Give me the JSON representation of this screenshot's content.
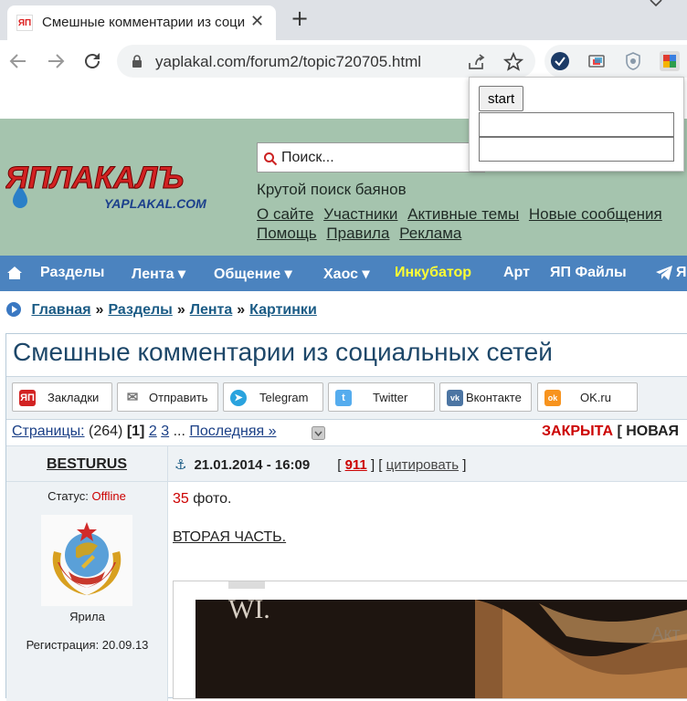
{
  "browser": {
    "tab_title": "Смешные комментарии из социальных сетей",
    "tab_favicon_text": "ЯП",
    "close_glyph": "✕",
    "new_tab_glyph": "+",
    "url": "yaplakal.com/forum2/topic720705.html"
  },
  "popup": {
    "button_label": "start",
    "input1_value": "",
    "input2_value": ""
  },
  "header": {
    "search_placeholder": "Поиск...",
    "search_caption": "Крутой поиск баянов",
    "links_row1": [
      "О сайте",
      "Участники",
      "Активные темы",
      "Новые сообщения"
    ],
    "links_row2": [
      "Помощь",
      "Правила",
      "Реклама"
    ]
  },
  "navbar": {
    "items": [
      "Разделы",
      "Лента ▾",
      "Общение ▾",
      "Хаос ▾",
      "Инкубатор",
      "Арт",
      "ЯП Файлы",
      "Я"
    ],
    "highlight_color": "#ffff33"
  },
  "breadcrumb": {
    "items": [
      "Главная",
      "Разделы",
      "Лента",
      "Картинки"
    ],
    "separator": "»"
  },
  "topic": {
    "title": "Смешные комментарии из социальных сетей",
    "share_buttons": [
      {
        "label": "Закладки",
        "icon": "yap-bookmark-icon",
        "mark": "ЯП",
        "color": "#d22222"
      },
      {
        "label": "Отправить",
        "icon": "mail-icon",
        "mark": "✉",
        "color": "#777777"
      },
      {
        "label": "Telegram",
        "icon": "telegram-icon",
        "mark": "➤",
        "color": "#2aa3de"
      },
      {
        "label": "Twitter",
        "icon": "twitter-icon",
        "mark": "t",
        "color": "#55acee"
      },
      {
        "label": "Вконтакте",
        "icon": "vk-icon",
        "mark": "vk",
        "color": "#4c75a3"
      },
      {
        "label": "OK.ru",
        "icon": "ok-icon",
        "mark": "ok",
        "color": "#f7931e"
      }
    ],
    "pages": {
      "label": "Страницы:",
      "count": "(264)",
      "current": "[1]",
      "p2": "2",
      "p3": "3",
      "ellipsis": "...",
      "last": "Последняя »"
    },
    "closed_label": "ЗАКРЫТА",
    "closed_after": "[ НОВАЯ"
  },
  "post": {
    "author": "BESTURUS",
    "date": "21.01.2014 - 16:09",
    "number": "911",
    "quote_label": "цитировать",
    "status_label": "Статус:",
    "status_value": "Offline",
    "avatar_caption": "Ярила",
    "registration": "Регистрация: 20.09.13",
    "photo_count": "35",
    "photo_suffix": "фото.",
    "second_part": "ВТОРАЯ ЧАСТЬ."
  },
  "watermark": "Акт",
  "colors": {
    "header_bg": "#a5c4ae",
    "nav_bg": "#4b83bf",
    "link_blue": "#1a5b85",
    "closed_red": "#cc0000"
  }
}
